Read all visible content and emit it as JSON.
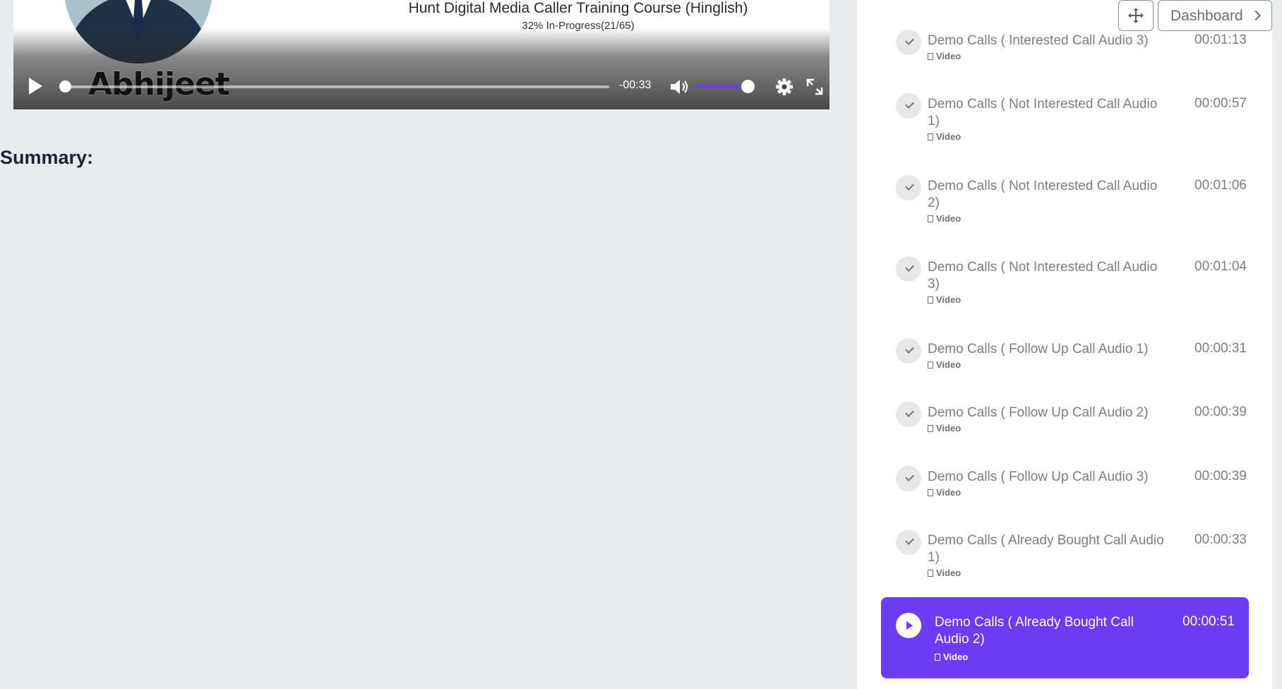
{
  "player": {
    "course_title": "Hunt Digital Media Caller Training Course (Hinglish)",
    "course_progress": "32% In-Progress(21/65)",
    "video_overlay_text": "Abhijeet",
    "time_remaining": "-00:33",
    "progress_fraction": 0.0,
    "volume_fraction": 0.9
  },
  "summary_heading": "Summary:",
  "toolbar": {
    "move_icon": "move-arrows-icon",
    "dashboard_label": "Dashboard"
  },
  "lessons": [
    {
      "title": "Demo Calls ( Interested Call Audio 3)",
      "duration": "00:01:13",
      "type": "Video",
      "completed": true
    },
    {
      "title": "Demo Calls ( Not Interested Call Audio 1)",
      "duration": "00:00:57",
      "type": "Video",
      "completed": true
    },
    {
      "title": "Demo Calls ( Not Interested Call Audio 2)",
      "duration": "00:01:06",
      "type": "Video",
      "completed": true
    },
    {
      "title": "Demo Calls ( Not Interested Call Audio 3)",
      "duration": "00:01:04",
      "type": "Video",
      "completed": true
    },
    {
      "title": "Demo Calls ( Follow Up Call Audio 1)",
      "duration": "00:00:31",
      "type": "Video",
      "completed": true
    },
    {
      "title": "Demo Calls ( Follow Up Call Audio 2)",
      "duration": "00:00:39",
      "type": "Video",
      "completed": true
    },
    {
      "title": "Demo Calls ( Follow Up Call Audio 3)",
      "duration": "00:00:39",
      "type": "Video",
      "completed": true
    },
    {
      "title": "Demo Calls ( Already Bought Call Audio 1)",
      "duration": "00:00:33",
      "type": "Video",
      "completed": true
    }
  ],
  "active_lesson": {
    "title": "Demo Calls ( Already Bought Call Audio 2)",
    "duration": "00:00:51",
    "type": "Video"
  },
  "colors": {
    "accent": "#6c3cf5",
    "page_bg": "#e9ecef",
    "muted_text": "#7a7e85"
  }
}
